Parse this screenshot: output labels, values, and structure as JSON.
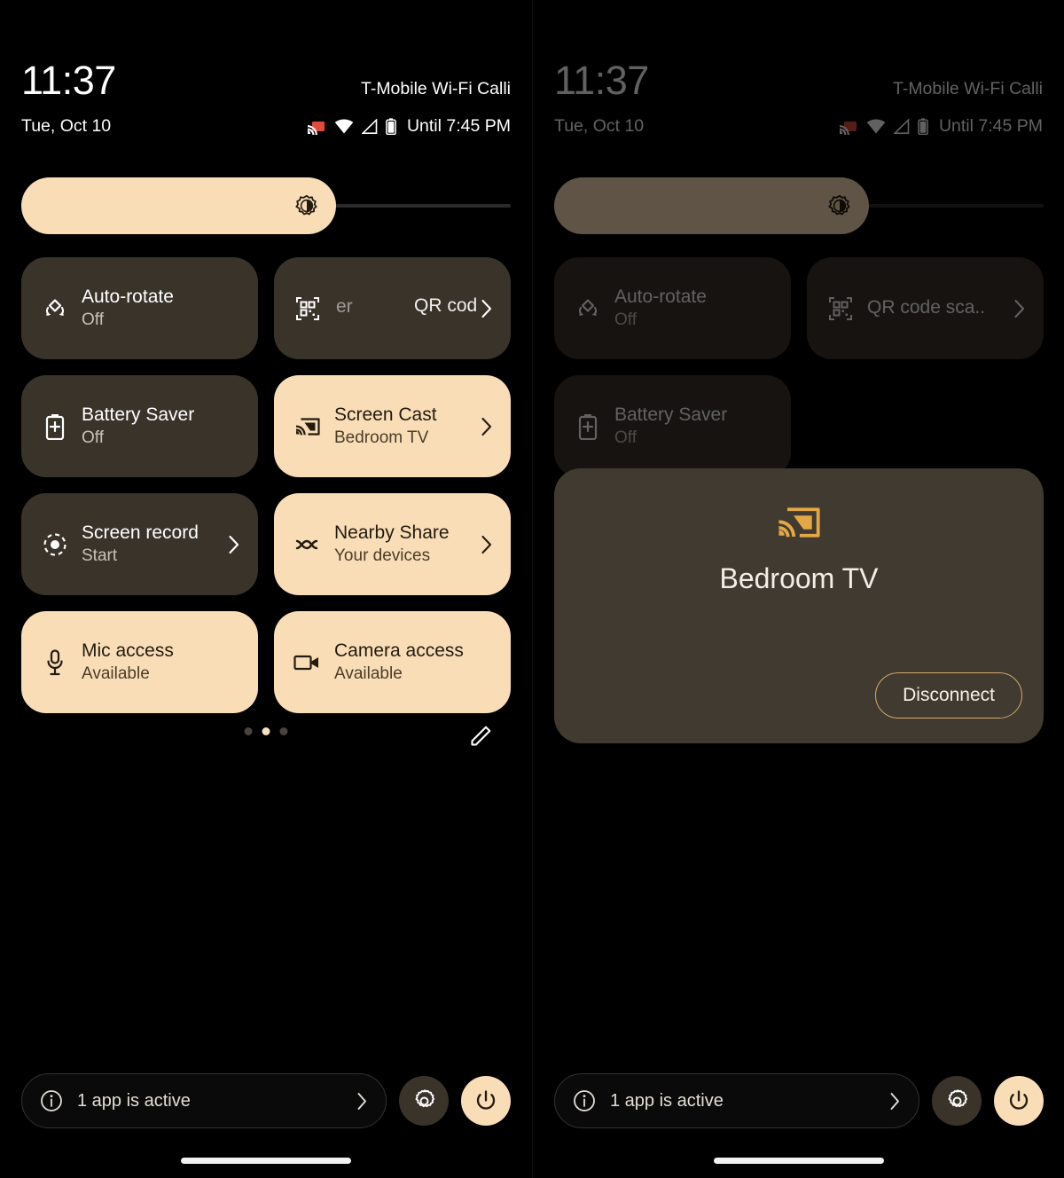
{
  "status_bar": {
    "clock": "11:37",
    "carrier": "T-Mobile Wi-Fi Calli",
    "date": "Tue, Oct 10",
    "battery_until": "Until 7:45 PM",
    "icons": [
      "cast-active-icon",
      "wifi-icon",
      "signal-icon",
      "battery-icon"
    ]
  },
  "brightness": {
    "name": "brightness-slider",
    "icon": "brightness-icon",
    "fill_percent": 64
  },
  "tiles": [
    {
      "title": "Auto-rotate",
      "subtitle": "Off",
      "icon": "auto-rotate-icon",
      "active": false,
      "chevron": false
    },
    {
      "title": "QR code scanner",
      "subtitle": "",
      "icon": "qr-code-icon",
      "active": false,
      "chevron": true,
      "anim_out": "er",
      "anim_in": "QR cod"
    },
    {
      "title": "Battery Saver",
      "subtitle": "Off",
      "icon": "battery-saver-icon",
      "active": false,
      "chevron": false
    },
    {
      "title": "Screen Cast",
      "subtitle": "Bedroom TV",
      "icon": "cast-icon",
      "active": true,
      "chevron": true
    },
    {
      "title": "Screen record",
      "subtitle": "Start",
      "icon": "screen-record-icon",
      "active": false,
      "chevron": true
    },
    {
      "title": "Nearby Share",
      "subtitle": "Your devices",
      "icon": "nearby-share-icon",
      "active": true,
      "chevron": true
    },
    {
      "title": "Mic access",
      "subtitle": "Available",
      "icon": "microphone-icon",
      "active": true,
      "chevron": false
    },
    {
      "title": "Camera access",
      "subtitle": "Available",
      "icon": "camera-icon",
      "active": true,
      "chevron": false
    }
  ],
  "tiles_right": [
    {
      "title": "Auto-rotate",
      "subtitle": "Off",
      "icon": "auto-rotate-icon",
      "chevron": false
    },
    {
      "title": "QR code sca..",
      "subtitle": "",
      "icon": "qr-code-icon",
      "chevron": true
    },
    {
      "title": "Battery Saver",
      "subtitle": "Off",
      "icon": "battery-saver-icon",
      "chevron": false
    }
  ],
  "pager": {
    "count": 3,
    "active_index": 1,
    "edit_icon": "pencil-edit-icon"
  },
  "footer": {
    "apps_label": "1 app is active",
    "info_icon": "info-icon",
    "chevron_icon": "chevron-right-icon",
    "settings_icon": "gear-icon",
    "power_icon": "power-icon"
  },
  "cast_dialog": {
    "icon": "cast-icon",
    "device_name": "Bedroom TV",
    "disconnect_label": "Disconnect"
  },
  "colors": {
    "background": "#000000",
    "tile_inactive": "#3A332A",
    "tile_active": "#F9DDB7",
    "dialog_bg": "#403A30",
    "accent": "#E3A845",
    "disconnect_border": "#D6A96A"
  }
}
